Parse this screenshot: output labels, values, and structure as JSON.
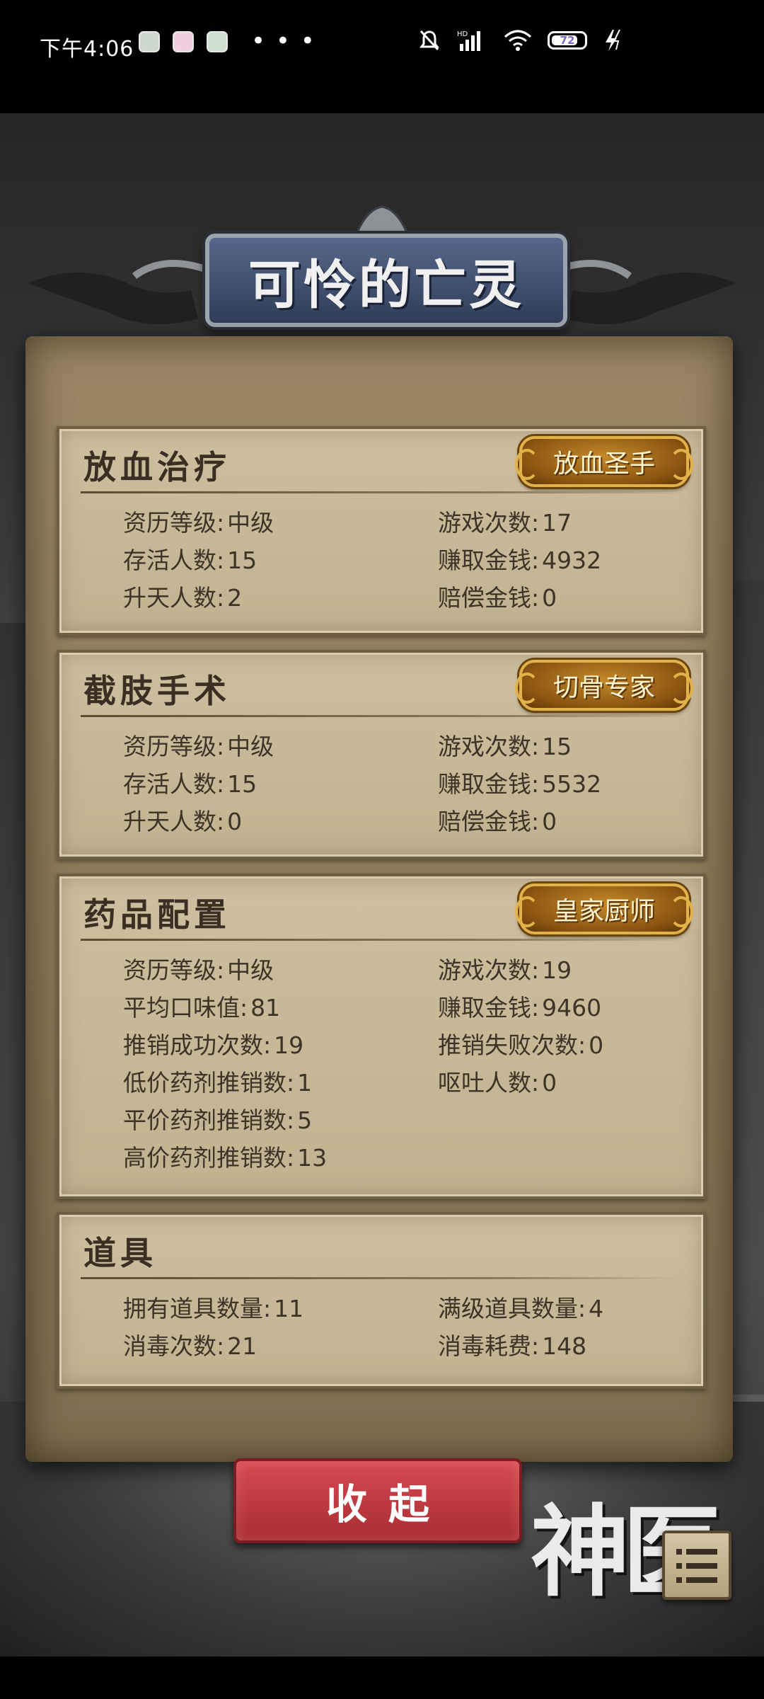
{
  "status_bar": {
    "time": "下午4:06",
    "more": "• • •",
    "battery_level": "72",
    "icons": [
      "mute-icon",
      "hd-signal-icon",
      "wifi-icon",
      "battery-icon",
      "charging-icon"
    ]
  },
  "title": "可怜的亡灵",
  "sections": {
    "bloodletting": {
      "title": "放血治疗",
      "badge": "放血圣手",
      "stats": [
        {
          "label": "资历等级:",
          "value": "中级"
        },
        {
          "label": "游戏次数:",
          "value": "17"
        },
        {
          "label": "存活人数:",
          "value": "15"
        },
        {
          "label": "赚取金钱:",
          "value": "4932"
        },
        {
          "label": "升天人数:",
          "value": "2"
        },
        {
          "label": "赔偿金钱:",
          "value": "0"
        }
      ]
    },
    "amputation": {
      "title": "截肢手术",
      "badge": "切骨专家",
      "stats": [
        {
          "label": "资历等级:",
          "value": "中级"
        },
        {
          "label": "游戏次数:",
          "value": "15"
        },
        {
          "label": "存活人数:",
          "value": "15"
        },
        {
          "label": "赚取金钱:",
          "value": "5532"
        },
        {
          "label": "升天人数:",
          "value": "0"
        },
        {
          "label": "赔偿金钱:",
          "value": "0"
        }
      ]
    },
    "medicine": {
      "title": "药品配置",
      "badge": "皇家厨师",
      "stats": [
        {
          "label": "资历等级:",
          "value": "中级"
        },
        {
          "label": "游戏次数:",
          "value": "19"
        },
        {
          "label": "平均口味值:",
          "value": "81"
        },
        {
          "label": "赚取金钱:",
          "value": "9460"
        },
        {
          "label": "推销成功次数:",
          "value": "19"
        },
        {
          "label": "推销失败次数:",
          "value": "0"
        },
        {
          "label": "低价药剂推销数:",
          "value": "1"
        },
        {
          "label": "呕吐人数:",
          "value": "0"
        },
        {
          "label": "平价药剂推销数:",
          "value": "5"
        },
        {
          "label": "",
          "value": ""
        },
        {
          "label": "高价药剂推销数:",
          "value": "13"
        },
        {
          "label": "",
          "value": ""
        }
      ]
    },
    "items": {
      "title": "道具",
      "stats": [
        {
          "label": "拥有道具数量:",
          "value": "11"
        },
        {
          "label": "满级道具数量:",
          "value": "4"
        },
        {
          "label": "消毒次数:",
          "value": "21"
        },
        {
          "label": "消毒耗费:",
          "value": "148"
        }
      ]
    }
  },
  "collapse_button": "收起",
  "logo_text": "神医",
  "colors": {
    "parchment": "#c8ba99",
    "badge_gold": "#c58a2a",
    "button_red": "#c23c43",
    "title_plaque": "#45567a"
  }
}
